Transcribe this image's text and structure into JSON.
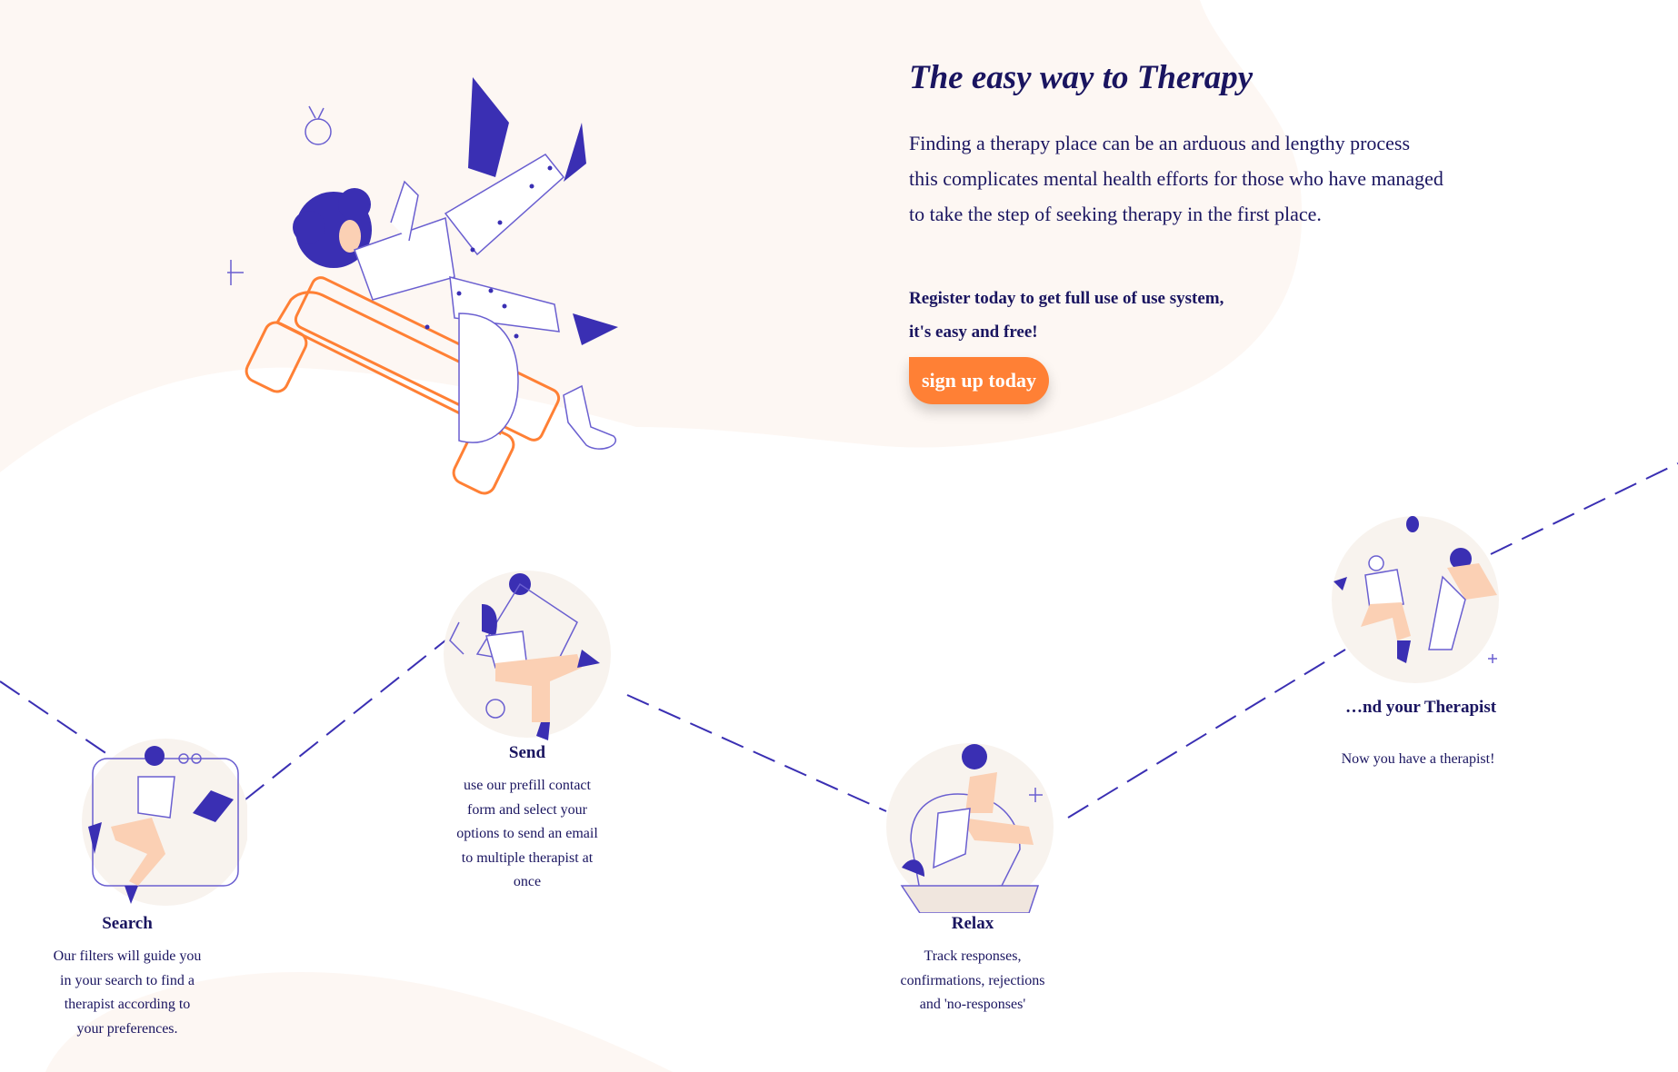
{
  "hero": {
    "title": "The easy way to Therapy",
    "description_lines": [
      "Finding a therapy place can be an arduous and lengthy process",
      "this complicates mental health efforts for those who have managed",
      "to take the step of seeking therapy in the first place."
    ],
    "register_lines": [
      "Register today to get full use of use system,",
      "it's easy and free!"
    ],
    "signup_label": "sign up today"
  },
  "steps": [
    {
      "title": "Search",
      "desc_lines": [
        "Our filters will guide you",
        "in your search to find a",
        "therapist according to",
        "your preferences."
      ]
    },
    {
      "title": "Send",
      "desc_lines": [
        "use our prefill contact",
        "form and select your",
        "options to send an email",
        "to multiple therapist at",
        "once"
      ]
    },
    {
      "title": "Relax",
      "desc_lines": [
        "Track responses,",
        "confirmations, rejections",
        "and 'no-responses'"
      ]
    },
    {
      "title": "…nd your Therapist",
      "desc_lines": [
        "Now you have a therapist!"
      ]
    }
  ],
  "colors": {
    "navy": "#1a1560",
    "purple": "#3a2fb3",
    "orange": "#ff8035",
    "peach": "#fbd0b4",
    "cream": "#fdf7f3"
  }
}
